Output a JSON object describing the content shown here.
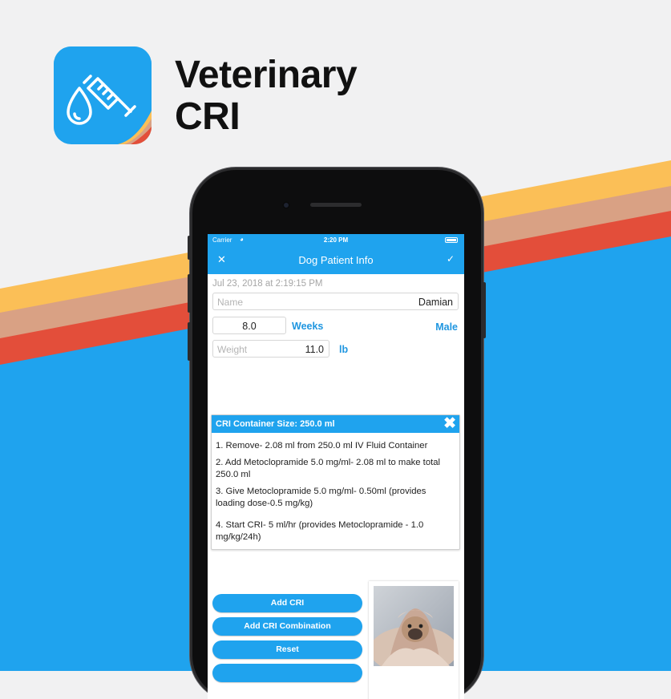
{
  "app": {
    "title_line1": "Veterinary",
    "title_line2": "CRI",
    "icon": "drop-and-syringe-icon"
  },
  "colors": {
    "accent": "#1fa3ee",
    "stripe_yellow": "#fbbf57",
    "stripe_tan": "#d9a184",
    "stripe_red": "#e34e3a",
    "background": "#f1f1f2"
  },
  "status_bar": {
    "carrier": "Carrier",
    "time": "2:20 PM"
  },
  "nav": {
    "close_icon": "close-icon",
    "title": "Dog Patient Info",
    "confirm_icon": "checkmark-icon"
  },
  "form": {
    "timestamp": "Jul 23, 2018 at 2:19:15 PM",
    "name_placeholder": "Name",
    "name_value": "Damian",
    "age_value": "8.0",
    "age_unit": "Weeks",
    "sex": "Male",
    "weight_placeholder": "Weight",
    "weight_value": "11.0",
    "weight_unit": "lb"
  },
  "cri": {
    "header": "CRI Container Size: 250.0 ml",
    "steps": [
      "1. Remove- 2.08 ml from 250.0 ml IV Fluid Container",
      "2. Add Metoclopramide 5.0 mg/ml- 2.08 ml to make total 250.0 ml",
      "3. Give Metoclopramide 5.0 mg/ml- 0.50ml (provides loading dose-0.5 mg/kg)",
      "4. Start CRI- 5 ml/hr (provides Metoclopramide - 1.0 mg/kg/24h)"
    ]
  },
  "buttons": {
    "add_cri": "Add CRI",
    "add_cri_combination": "Add CRI Combination",
    "reset": "Reset"
  }
}
